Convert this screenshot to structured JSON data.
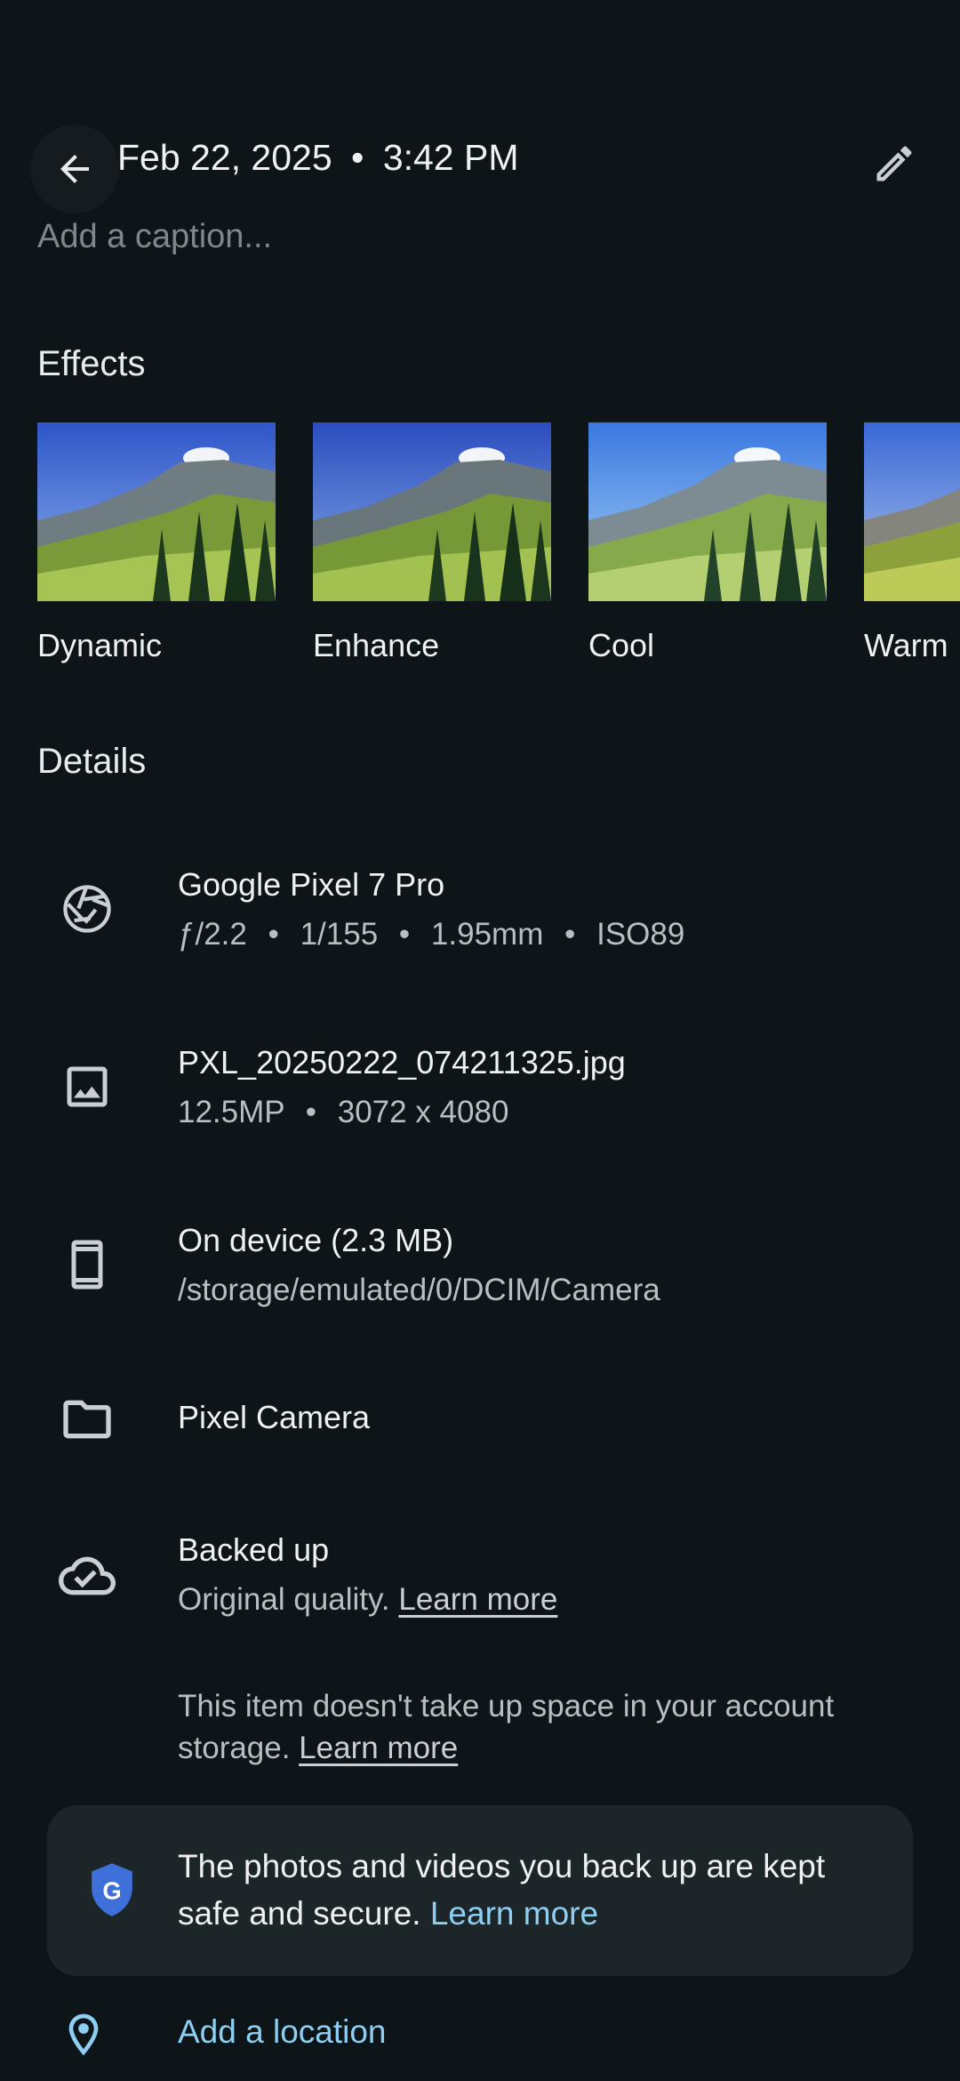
{
  "header": {
    "date": "Feb 22, 2025",
    "separator": "•",
    "time": "3:42 PM",
    "caption_placeholder": "Add a caption..."
  },
  "effects": {
    "title": "Effects",
    "items": [
      {
        "label": "Dynamic"
      },
      {
        "label": "Enhance"
      },
      {
        "label": "Cool"
      },
      {
        "label": "Warm"
      }
    ]
  },
  "details": {
    "title": "Details",
    "camera": {
      "title": "Google Pixel 7 Pro",
      "aperture": "ƒ/2.2",
      "shutter": "1/155",
      "focal": "1.95mm",
      "iso": "ISO89",
      "sep": "•"
    },
    "file": {
      "title": "PXL_20250222_074211325.jpg",
      "megapixels": "12.5MP",
      "dimensions": "3072 x 4080",
      "sep": "•"
    },
    "device": {
      "title": "On device (2.3 MB)",
      "path": "/storage/emulated/0/DCIM/Camera"
    },
    "folder": {
      "title": "Pixel Camera"
    },
    "backup": {
      "title": "Backed up",
      "quality": "Original quality.",
      "learn_more": "Learn more"
    },
    "storage_note": {
      "text": "This item doesn't take up space in your account storage.",
      "learn_more": "Learn more"
    },
    "secure": {
      "text": "The photos and videos you back up are kept safe and secure.",
      "learn_more": "Learn more"
    },
    "location": {
      "label": "Add a location"
    }
  },
  "icons": {
    "back": "arrow-left-icon",
    "edit": "pencil-icon",
    "camera": "aperture-icon",
    "file": "image-icon",
    "device": "phone-icon",
    "folder": "folder-icon",
    "backup": "cloud-done-icon",
    "secure": "google-shield-icon",
    "location": "location-pin-icon"
  },
  "colors": {
    "background": "#0e1518",
    "accent_link": "#8dcff2",
    "shield_blue": "#3f6fd8",
    "card": "#1c2528"
  }
}
